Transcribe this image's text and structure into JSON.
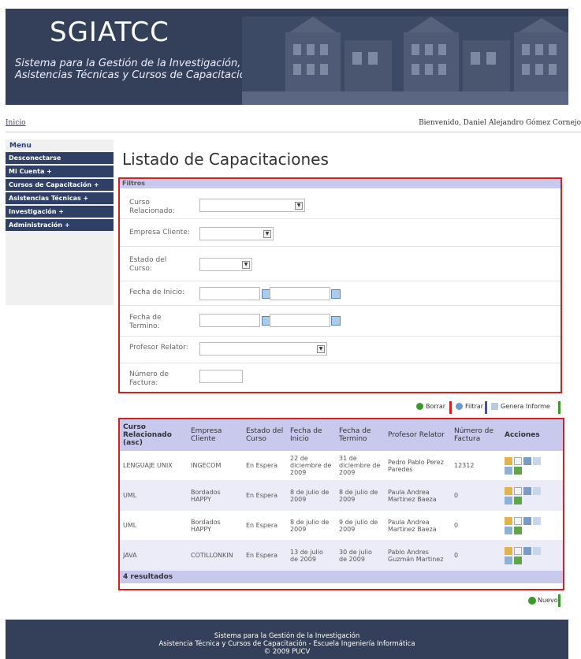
{
  "header": {
    "logo": "SGIATCC",
    "subtitle_line1": "Sistema para la Gestión de la Investigación,",
    "subtitle_line2": "Asistencias Técnicas y Cursos de Capacitación"
  },
  "topbar": {
    "home_link": "Inicio",
    "welcome": "Bienvenido, Daniel Alejandro Gómez Cornejo"
  },
  "sidebar": {
    "title": "Menu",
    "items": [
      {
        "label": "Desconectarse"
      },
      {
        "label": "Mi Cuenta +"
      },
      {
        "label": "Cursos de Capacitación +"
      },
      {
        "label": "Asistencias Técnicas +"
      },
      {
        "label": "Investigación +"
      },
      {
        "label": "Administración +"
      }
    ]
  },
  "page": {
    "title": "Listado de Capacitaciones"
  },
  "filters": {
    "title": "Filtros",
    "curso_label": "Curso Relacionado:",
    "empresa_label": "Empresa Cliente:",
    "estado_label": "Estado del Curso:",
    "fecha_inicio_label": "Fecha de Inicio:",
    "fecha_termino_label": "Fecha de Termino:",
    "profesor_label": "Profesor Relator:",
    "factura_label": "Número de Factura:"
  },
  "actions": {
    "borrar": "Borrar",
    "filtrar": "Filtrar",
    "informe": "Genera Informe",
    "nuevo": "Nuevo"
  },
  "table": {
    "columns": [
      "Curso Relacionado (asc)",
      "Empresa Cliente",
      "Estado del Curso",
      "Fecha de Inicio",
      "Fecha de Termino",
      "Profesor Relator",
      "Número de Factura",
      "Acciones"
    ],
    "rows": [
      {
        "curso": "LENGUAJE UNIX",
        "empresa": "INGECOM",
        "estado": "En Espera",
        "inicio": "22 de diciembre de 2009",
        "termino": "31 de diciembre de 2009",
        "profesor": "Pedro Pablo Perez Paredes",
        "factura": "12312"
      },
      {
        "curso": "UML",
        "empresa": "Bordados HAPPY",
        "estado": "En Espera",
        "inicio": "8 de julio de 2009",
        "termino": "8 de julio de 2009",
        "profesor": "Paula Andrea Martinez Baeza",
        "factura": "0"
      },
      {
        "curso": "UML",
        "empresa": "Bordados HAPPY",
        "estado": "En Espera",
        "inicio": "8 de julio de 2009",
        "termino": "9 de julio de 2009",
        "profesor": "Paula Andrea Martinez Baeza",
        "factura": "0"
      },
      {
        "curso": "JAVA",
        "empresa": "COTILLONKIN",
        "estado": "En Espera",
        "inicio": "13 de julio de 2009",
        "termino": "30 de julio de 2009",
        "profesor": "Pablo Andres Guzmán Martinez",
        "factura": "0"
      }
    ],
    "total": "4 resultados"
  },
  "footer": {
    "line1": "Sistema para la Gestión de la Investigación",
    "line2": "Asistencia Técnica y Cursos de Capacitación - Escuela Ingeniería Informática",
    "line3": "© 2009 PUCV"
  }
}
